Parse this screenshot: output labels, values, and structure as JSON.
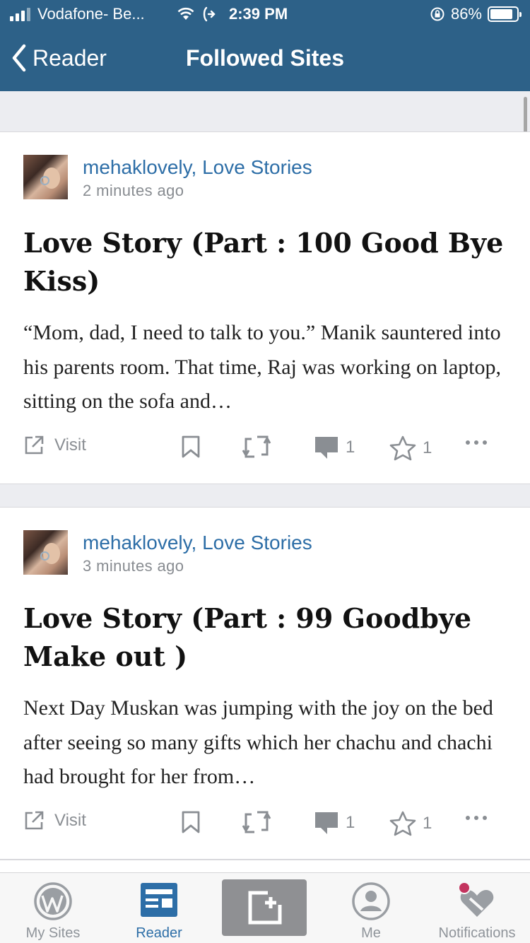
{
  "status_bar": {
    "carrier": "Vodafone- Be...",
    "time": "2:39 PM",
    "battery": "86%",
    "battery_level": 0.86
  },
  "nav": {
    "back_label": "Reader",
    "title": "Followed Sites"
  },
  "posts": [
    {
      "site": "mehaklovely, Love Stories",
      "time_ago": "2 minutes ago",
      "title": "Love Story (Part : 100 Good Bye Kiss)",
      "excerpt": "“Mom, dad, I need to talk to you.” Manik sauntered into his parents room. That time, Raj was working on laptop, sitting on the sofa and…",
      "visit_label": "Visit",
      "comments": "1",
      "likes": "1"
    },
    {
      "site": "mehaklovely, Love Stories",
      "time_ago": "3 minutes ago",
      "title": "Love Story (Part : 99 Goodbye Make out )",
      "excerpt": "Next Day Muskan was jumping with the joy on the bed after seeing so many gifts which her chachu and chachi had brought for her from…",
      "visit_label": "Visit",
      "comments": "1",
      "likes": "1"
    }
  ],
  "tabs": [
    {
      "label": "My Sites",
      "icon": "wordpress-icon"
    },
    {
      "label": "Reader",
      "icon": "reader-icon",
      "active": true
    },
    {
      "label": "",
      "icon": "write-icon"
    },
    {
      "label": "Me",
      "icon": "person-icon"
    },
    {
      "label": "Notifications",
      "icon": "notifications-icon"
    }
  ],
  "colors": {
    "nav_bg": "#2d6188",
    "link": "#2d6ea7",
    "icon_gray": "#8a8e93",
    "notification_dot": "#c3335e"
  }
}
